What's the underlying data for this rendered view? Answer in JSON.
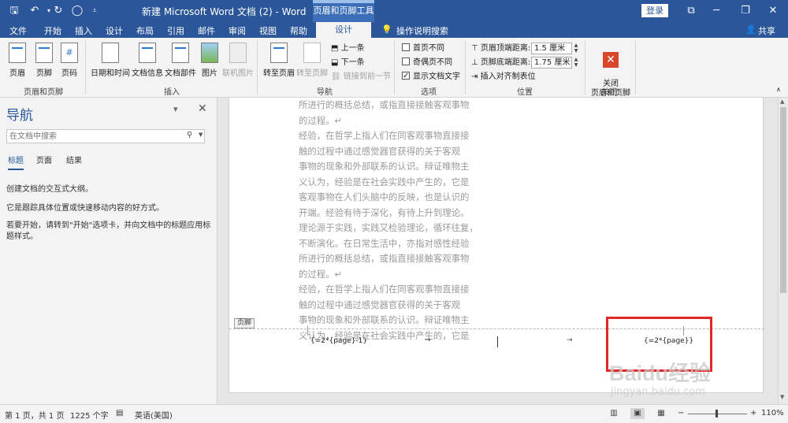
{
  "titlebar": {
    "doc_title": "新建 Microsoft Word 文档 (2)  -  Word",
    "context_tool": "页眉和页脚工具",
    "login": "登录"
  },
  "tabs": [
    "文件",
    "开始",
    "插入",
    "设计",
    "布局",
    "引用",
    "邮件",
    "审阅",
    "视图",
    "帮助"
  ],
  "active_tab": "设计",
  "tell_me": "操作说明搜索",
  "share": "共享",
  "ribbon": {
    "hf_group": {
      "label": "页眉和页脚",
      "header": "页眉",
      "footer": "页脚",
      "page_number": "页码"
    },
    "insert_group": {
      "label": "插入",
      "date_time": "日期和时间",
      "doc_info": "文档信息",
      "doc_parts": "文档部件",
      "picture": "图片",
      "online_picture": "联机图片"
    },
    "nav_group": {
      "label": "导航",
      "goto_header": "转至页眉",
      "goto_footer": "转至页脚",
      "previous": "上一条",
      "next": "下一条",
      "link_previous": "链接到前一节"
    },
    "options_group": {
      "label": "选项",
      "different_first_page": {
        "label": "首页不同",
        "checked": false
      },
      "different_odd_even": {
        "label": "奇偶页不同",
        "checked": false
      },
      "show_doc_text": {
        "label": "显示文档文字",
        "checked": true
      }
    },
    "position_group": {
      "label": "位置",
      "header_from_top": "页眉顶端距离:",
      "header_value": "1.5 厘米",
      "footer_from_bottom": "页脚底端距离:",
      "footer_value": "1.75 厘米",
      "insert_align_tab": "插入对齐制表位"
    },
    "close_group": {
      "label": "关闭",
      "close_hf": "关闭\n页眉和页脚"
    }
  },
  "navpane": {
    "title": "导航",
    "search_placeholder": "在文档中搜索",
    "tabs": [
      "标题",
      "页面",
      "结果"
    ],
    "messages": [
      "创建文档的交互式大纲。",
      "它是跟踪具体位置或快速移动内容的好方式。",
      "若要开始，请转到\"开始\"选项卡，并向文档中的标题应用标题样式。"
    ]
  },
  "document": {
    "body_lines": [
      "所进行的概括总结，或指直接接触客观事物",
      "的过程。↵",
      "经验，在哲学上指人们在同客观事物直接接",
      "触的过程中通过感觉器官获得的关于客观",
      "事物的现象和外部联系的认识。辩证唯物主",
      "义认为，经验是在社会实践中产生的，它是",
      "客观事物在人们头脑中的反映，也是认识的",
      "开端。经验有待于深化，有待上升到理论。",
      "理论源于实践，实践又检验理论，循环往复，",
      "不断演化。在日常生活中，亦指对感性经验",
      "所进行的概括总结，或指直接接触客观事物",
      "的过程。↵",
      "经验，在哲学上指人们在同客观事物直接接",
      "触的过程中通过感觉器官获得的关于客观",
      "事物的现象和外部联系的认识。辩证唯物主",
      "义认为，经验是在社会实践中产生的，它是"
    ],
    "footer_tag": "页脚",
    "footer_field_left": "{=2*{page}-1}",
    "footer_field_right": "{=2*{page}}",
    "tab_arrow": "→"
  },
  "statusbar": {
    "page_info": "第 1 页，共 1 页",
    "word_count": "1225 个字",
    "language": "英语(美国)",
    "zoom": "110%"
  },
  "watermark": {
    "logo": "Baidu经验",
    "url": "jingyan.baidu.com"
  },
  "colors": {
    "word_blue": "#2b579a",
    "highlight_red": "#e02828",
    "ribbon_bg": "#f3f3f3"
  }
}
